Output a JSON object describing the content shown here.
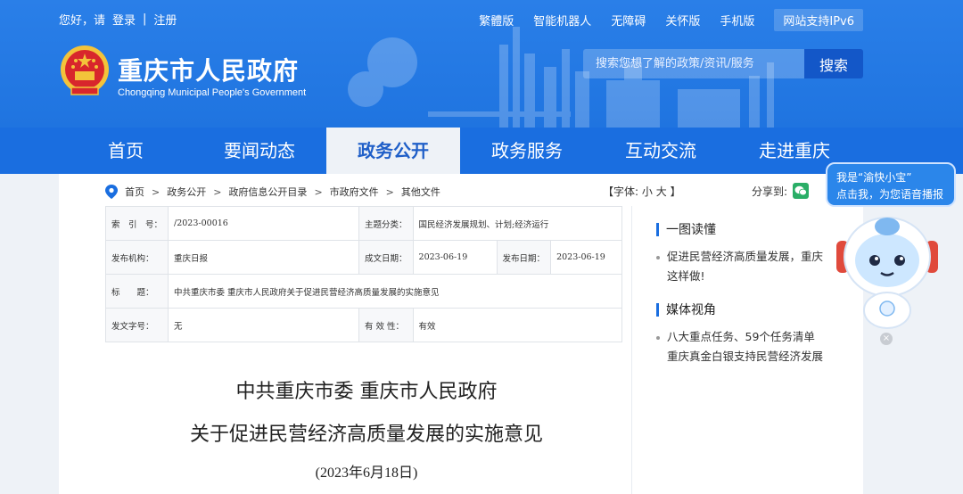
{
  "topbar": {
    "greeting": "您好，请",
    "login": "登录",
    "divider": "|",
    "register": "注册",
    "links": [
      "繁體版",
      "智能机器人",
      "无障碍",
      "关怀版",
      "手机版"
    ],
    "ipv6": "网站支持IPv6"
  },
  "site": {
    "title": "重庆市人民政府",
    "subtitle": "Chongqing Municipal People's Government"
  },
  "search": {
    "placeholder": "搜索您想了解的政策/资讯/服务",
    "button": "搜索"
  },
  "nav": {
    "items": [
      "首页",
      "要闻动态",
      "政务公开",
      "政务服务",
      "互动交流",
      "走进重庆"
    ],
    "active_index": 2
  },
  "breadcrumb": [
    "首页",
    "政务公开",
    "政府信息公开目录",
    "市政府文件",
    "其他文件"
  ],
  "font_size": {
    "label": "【字体:",
    "large": "大",
    "small": "小",
    "close": "】"
  },
  "share": {
    "label": "分享到:"
  },
  "info": {
    "index_label": "索　引　号：",
    "index_value": "/2023-00016",
    "topic_label": "主题分类：",
    "topic_value": "国民经济发展规划、计划;经济运行",
    "publisher_label": "发布机构：",
    "publisher_value": "重庆日报",
    "created_label": "成文日期：",
    "created_value": "2023-06-19",
    "published_label": "发布日期：",
    "published_value": "2023-06-19",
    "title_label": "标　　题：",
    "title_value": "中共重庆市委 重庆市人民政府关于促进民营经济高质量发展的实施意见",
    "docno_label": "发文字号：",
    "docno_value": "无",
    "validity_label": "有 效 性：",
    "validity_value": "有效"
  },
  "article": {
    "title_line1": "中共重庆市委 重庆市人民政府",
    "title_line2": "关于促进民营经济高质量发展的实施意见",
    "date": "(2023年6月18日)"
  },
  "sidebar": {
    "section1_title": "一图读懂",
    "section1_item_line1": "促进民营经济高质量发展，重庆",
    "section1_item_line2": "这样做!",
    "section2_title": "媒体视角",
    "section2_item1": "八大重点任务、59个任务清单",
    "section2_item2": "重庆真金白银支持民营经济发展"
  },
  "assistant": {
    "line1": "我是“渝快小宝”",
    "line2": "点击我，为您语音播报",
    "close": "×"
  },
  "colors": {
    "brand_blue": "#1a6ee0",
    "header_blue": "#2a7fe8",
    "wechat_green": "#2aae67"
  }
}
